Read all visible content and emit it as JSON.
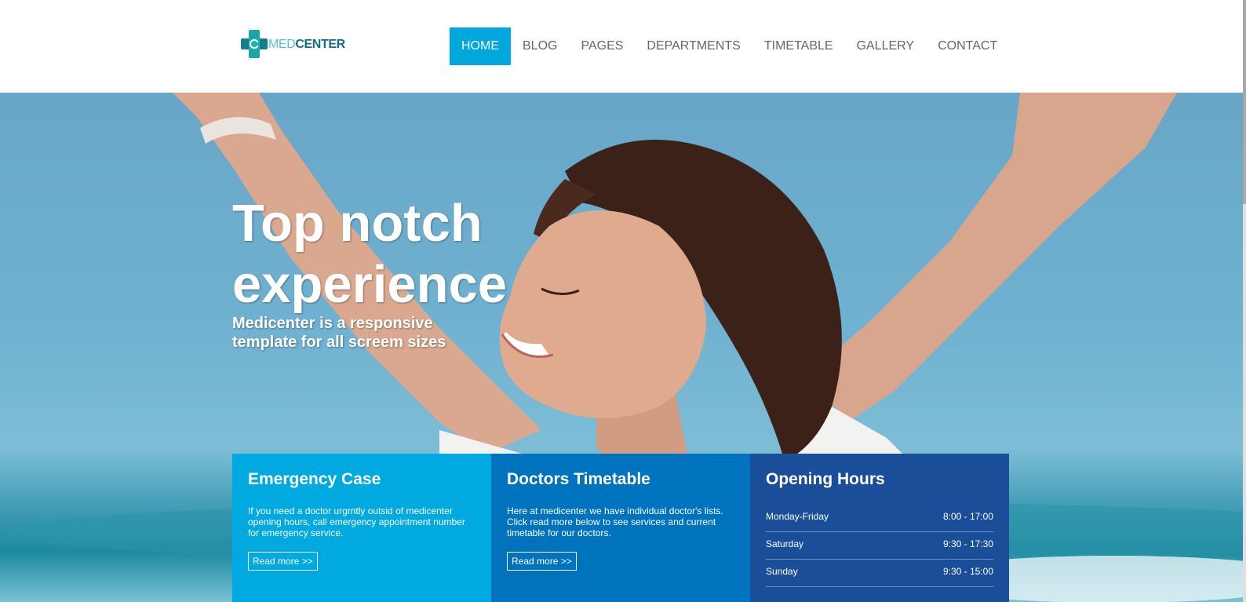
{
  "header": {
    "logo": {
      "part1": "MED",
      "part2": "CENTER"
    },
    "nav": [
      {
        "label": "HOME",
        "active": true
      },
      {
        "label": "BLOG",
        "active": false
      },
      {
        "label": "PAGES",
        "active": false
      },
      {
        "label": "DEPARTMENTS",
        "active": false
      },
      {
        "label": "TIMETABLE",
        "active": false
      },
      {
        "label": "GALLERY",
        "active": false
      },
      {
        "label": "CONTACT",
        "active": false
      }
    ]
  },
  "hero": {
    "title": "Top notch experience",
    "subtitle": "Medicenter is a responsive template for all screem sizes"
  },
  "boxes": {
    "emergency": {
      "title": "Emergency Case",
      "text": "If you need a doctor urgrntly outsid of medicenter opening hours, call emergency appointment number for emergency service.",
      "button": "Read more >>"
    },
    "timetable": {
      "title": "Doctors Timetable",
      "text": "Here at medicenter we have individual doctor's lists. Click read more below to see services and current timetable for our doctors.",
      "button": "Read more >>"
    },
    "hours": {
      "title": "Opening Hours",
      "rows": [
        {
          "day": "Monday-Friday",
          "time": "8:00 - 17:00"
        },
        {
          "day": "Saturday",
          "time": "9:30 - 17:30"
        },
        {
          "day": "Sunday",
          "time": "9:30 - 15:00"
        }
      ]
    }
  },
  "colors": {
    "accent": "#00a8dd",
    "emergency_box": "#00a9df",
    "timetable_box": "#0073bf",
    "hours_box": "#1a4e98",
    "nav_text": "#666666"
  }
}
